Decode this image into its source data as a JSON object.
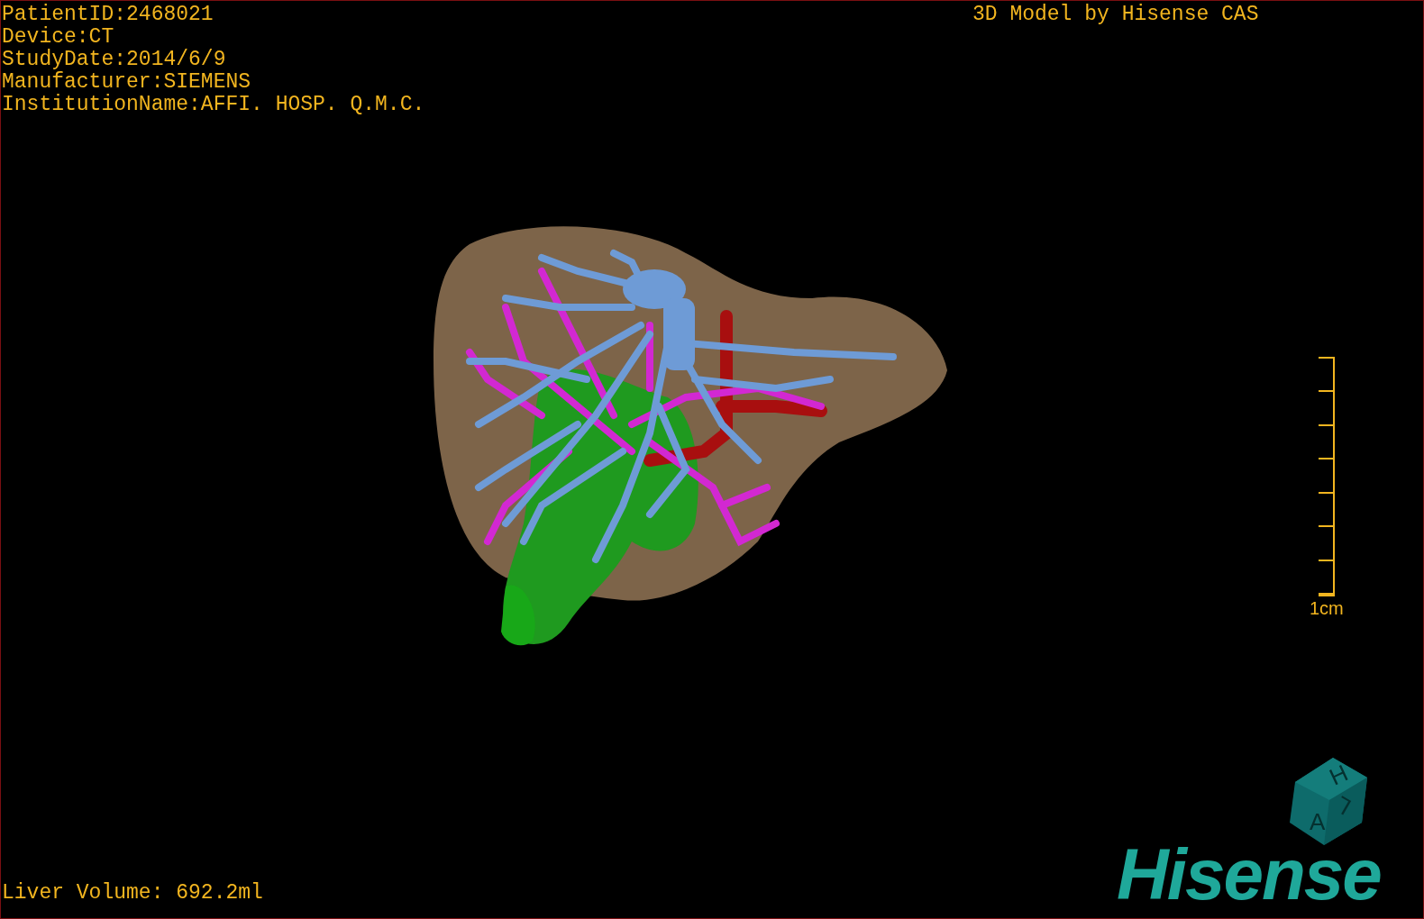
{
  "info_lines": [
    "PatientID:2468021",
    "Device:CT",
    "StudyDate:2014/6/9",
    "Manufacturer:SIEMENS",
    "InstitutionName:AFFI. HOSP. Q.M.C."
  ],
  "title": "3D Model by Hisense CAS",
  "scale_bar": {
    "label": "1cm"
  },
  "orientation_cube": {
    "faces": [
      "H",
      "A",
      "L"
    ]
  },
  "logo": "Hisense",
  "liver_volume": "Liver Volume: 692.2ml"
}
